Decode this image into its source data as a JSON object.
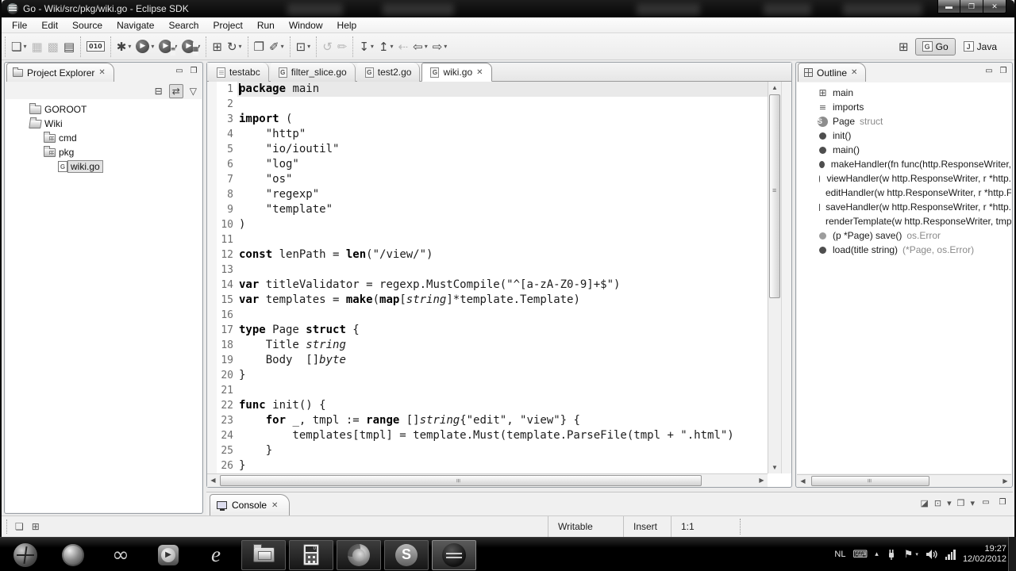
{
  "window": {
    "title": "Go - Wiki/src/pkg/wiki.go - Eclipse SDK",
    "minimize_glyph": "▬",
    "restore_glyph": "❐",
    "close_glyph": "✕"
  },
  "menubar": {
    "items": [
      "File",
      "Edit",
      "Source",
      "Navigate",
      "Search",
      "Project",
      "Run",
      "Window",
      "Help"
    ]
  },
  "toolbar": {
    "groups": [
      {
        "buttons": [
          {
            "name": "new-wizard",
            "glyph": "❏",
            "dd": true
          },
          {
            "name": "save",
            "glyph": "▦",
            "disabled": true
          },
          {
            "name": "save-all",
            "glyph": "▩",
            "disabled": true
          },
          {
            "name": "print",
            "glyph": "▤"
          }
        ]
      },
      {
        "buttons": [
          {
            "name": "binary-file",
            "glyph": "010",
            "text": true
          }
        ]
      },
      {
        "buttons": [
          {
            "name": "debug",
            "glyph": "✱",
            "dd": true
          },
          {
            "name": "run",
            "glyph": "▶",
            "circle": true,
            "dd": true
          },
          {
            "name": "run-history",
            "glyph": "▶",
            "circle": true,
            "sub": "≡",
            "dd": true
          },
          {
            "name": "external-tools",
            "glyph": "▶",
            "circle": true,
            "sub": "▦",
            "dd": true
          }
        ]
      },
      {
        "buttons": [
          {
            "name": "new-project",
            "glyph": "⊞"
          },
          {
            "name": "refresh",
            "glyph": "↻",
            "dd": true
          }
        ]
      },
      {
        "buttons": [
          {
            "name": "open-resource",
            "glyph": "❐"
          },
          {
            "name": "open-wand",
            "glyph": "✐",
            "dd": true
          }
        ]
      },
      {
        "buttons": [
          {
            "name": "toggle-mark-occurrences",
            "glyph": "⊡",
            "dd": true
          }
        ]
      },
      {
        "buttons": [
          {
            "name": "synchronize",
            "glyph": "↺",
            "disabled": true
          },
          {
            "name": "format",
            "glyph": "✏",
            "disabled": true
          }
        ]
      },
      {
        "buttons": [
          {
            "name": "last-edit-location",
            "glyph": "↧",
            "dd": true
          },
          {
            "name": "go-into",
            "glyph": "↥",
            "dd": true
          },
          {
            "name": "back-history",
            "glyph": "⇠",
            "disabled": true
          },
          {
            "name": "back",
            "glyph": "⇦",
            "dd": true
          },
          {
            "name": "forward",
            "glyph": "⇨",
            "dd": true
          }
        ]
      }
    ]
  },
  "perspective": {
    "open_glyph": "⊞",
    "items": [
      {
        "label": "Go",
        "active": true
      },
      {
        "label": "Java",
        "active": false
      }
    ]
  },
  "explorer": {
    "title": "Project Explorer",
    "toolbar": {
      "collapse_glyph": "⊟",
      "link_glyph": "⇄",
      "menu_glyph": "▽"
    },
    "tree": [
      {
        "label": "GOROOT",
        "icon": "folder",
        "indent": 1
      },
      {
        "label": "Wiki",
        "icon": "folder-open",
        "indent": 1
      },
      {
        "label": "cmd",
        "icon": "package-folder",
        "indent": 2
      },
      {
        "label": "pkg",
        "icon": "package-folder",
        "indent": 2
      },
      {
        "label": "wiki.go",
        "icon": "go-file",
        "indent": 3,
        "selected": true
      }
    ]
  },
  "editor": {
    "tabs": [
      {
        "label": "testabc",
        "icon": "doc"
      },
      {
        "label": "filter_slice.go",
        "icon": "go"
      },
      {
        "label": "test2.go",
        "icon": "go"
      },
      {
        "label": "wiki.go",
        "icon": "go",
        "active": true,
        "close": true
      }
    ],
    "lines": [
      {
        "n": 1,
        "cur": true,
        "caret": true,
        "segs": [
          [
            "kw",
            "package"
          ],
          [
            "pl",
            " main"
          ]
        ]
      },
      {
        "n": 2,
        "segs": []
      },
      {
        "n": 3,
        "segs": [
          [
            "kw",
            "import"
          ],
          [
            "pl",
            " ("
          ]
        ]
      },
      {
        "n": 4,
        "segs": [
          [
            "pl",
            "    \"http\""
          ]
        ]
      },
      {
        "n": 5,
        "segs": [
          [
            "pl",
            "    \"io/ioutil\""
          ]
        ]
      },
      {
        "n": 6,
        "segs": [
          [
            "pl",
            "    \"log\""
          ]
        ]
      },
      {
        "n": 7,
        "segs": [
          [
            "pl",
            "    \"os\""
          ]
        ]
      },
      {
        "n": 8,
        "segs": [
          [
            "pl",
            "    \"regexp\""
          ]
        ]
      },
      {
        "n": 9,
        "segs": [
          [
            "pl",
            "    \"template\""
          ]
        ]
      },
      {
        "n": 10,
        "segs": [
          [
            "pl",
            ")"
          ]
        ]
      },
      {
        "n": 11,
        "segs": []
      },
      {
        "n": 12,
        "segs": [
          [
            "kw",
            "const"
          ],
          [
            "pl",
            " lenPath = "
          ],
          [
            "kw",
            "len"
          ],
          [
            "pl",
            "(\"/view/\")"
          ]
        ]
      },
      {
        "n": 13,
        "segs": []
      },
      {
        "n": 14,
        "segs": [
          [
            "kw",
            "var"
          ],
          [
            "pl",
            " titleValidator = regexp.MustCompile(\"^[a-zA-Z0-9]+$\")"
          ]
        ]
      },
      {
        "n": 15,
        "segs": [
          [
            "kw",
            "var"
          ],
          [
            "pl",
            " templates = "
          ],
          [
            "kw",
            "make"
          ],
          [
            "pl",
            "("
          ],
          [
            "kw",
            "map"
          ],
          [
            "pl",
            "["
          ],
          [
            "it",
            "string"
          ],
          [
            "pl",
            "]*template.Template)"
          ]
        ]
      },
      {
        "n": 16,
        "segs": []
      },
      {
        "n": 17,
        "segs": [
          [
            "kw",
            "type"
          ],
          [
            "pl",
            " Page "
          ],
          [
            "kw",
            "struct"
          ],
          [
            "pl",
            " {"
          ]
        ]
      },
      {
        "n": 18,
        "segs": [
          [
            "pl",
            "    Title "
          ],
          [
            "it",
            "string"
          ]
        ]
      },
      {
        "n": 19,
        "segs": [
          [
            "pl",
            "    Body  []"
          ],
          [
            "it",
            "byte"
          ]
        ]
      },
      {
        "n": 20,
        "segs": [
          [
            "pl",
            "}"
          ]
        ]
      },
      {
        "n": 21,
        "segs": []
      },
      {
        "n": 22,
        "segs": [
          [
            "kw",
            "func"
          ],
          [
            "pl",
            " init() {"
          ]
        ]
      },
      {
        "n": 23,
        "segs": [
          [
            "pl",
            "    "
          ],
          [
            "kw",
            "for"
          ],
          [
            "pl",
            " _, tmpl := "
          ],
          [
            "kw",
            "range"
          ],
          [
            "pl",
            " []"
          ],
          [
            "it",
            "string"
          ],
          [
            "pl",
            "{\"edit\", \"view\"} {"
          ]
        ]
      },
      {
        "n": 24,
        "segs": [
          [
            "pl",
            "        templates[tmpl] = template.Must(template.ParseFile(tmpl + \".html\")"
          ]
        ]
      },
      {
        "n": 25,
        "segs": [
          [
            "pl",
            "    }"
          ]
        ]
      },
      {
        "n": 26,
        "segs": [
          [
            "pl",
            "}"
          ]
        ]
      }
    ]
  },
  "outline": {
    "title": "Outline",
    "items": [
      {
        "icon": "pkg",
        "label": "main"
      },
      {
        "icon": "imports",
        "label": "imports"
      },
      {
        "icon": "struct",
        "label": "Page",
        "suffix": " struct"
      },
      {
        "icon": "dot",
        "label": "init()"
      },
      {
        "icon": "dot",
        "label": "main()"
      },
      {
        "icon": "dot",
        "label": "makeHandler(fn func(http.ResponseWriter,"
      },
      {
        "icon": "dot",
        "label": "viewHandler(w http.ResponseWriter, r *http."
      },
      {
        "icon": "dot",
        "label": "editHandler(w http.ResponseWriter, r *http.F"
      },
      {
        "icon": "dot",
        "label": "saveHandler(w http.ResponseWriter, r *http."
      },
      {
        "icon": "dot",
        "label": "renderTemplate(w http.ResponseWriter, tmp"
      },
      {
        "icon": "dotlight",
        "label": "(p *Page) save()",
        "suffix": " os.Error"
      },
      {
        "icon": "dot",
        "label": "load(title string)",
        "suffix": " (*Page, os.Error)"
      }
    ]
  },
  "console": {
    "title": "Console",
    "toolbar_glyphs": {
      "pin": "◪",
      "display": "⊡",
      "new_view": "❒"
    }
  },
  "statusbar": {
    "writable": "Writable",
    "mode": "Insert",
    "position": "1:1"
  },
  "taskbar": {
    "apps": [
      {
        "name": "start",
        "icon": "orb"
      },
      {
        "name": "globe",
        "icon": "globe"
      },
      {
        "name": "infinity",
        "icon": "infinity",
        "glyph": "∞"
      },
      {
        "name": "media-player",
        "icon": "wmp",
        "glyph": "▶"
      },
      {
        "name": "internet-explorer",
        "icon": "ie",
        "glyph": "e"
      },
      {
        "name": "file-explorer",
        "icon": "explorer",
        "boxed": true
      },
      {
        "name": "calculator",
        "icon": "calc",
        "boxed": true
      },
      {
        "name": "firefox",
        "icon": "firefox",
        "boxed": true
      },
      {
        "name": "skype",
        "icon": "skype",
        "boxed": true,
        "glyph": "S"
      },
      {
        "name": "eclipse",
        "icon": "eclipse",
        "boxed": true,
        "active": true
      }
    ],
    "tray": {
      "lang": "NL",
      "keyboard_glyph": "⌨",
      "chevron_glyph": "▴",
      "flag_glyph": "⚑",
      "time": "19:27",
      "date": "12/02/2012"
    }
  }
}
